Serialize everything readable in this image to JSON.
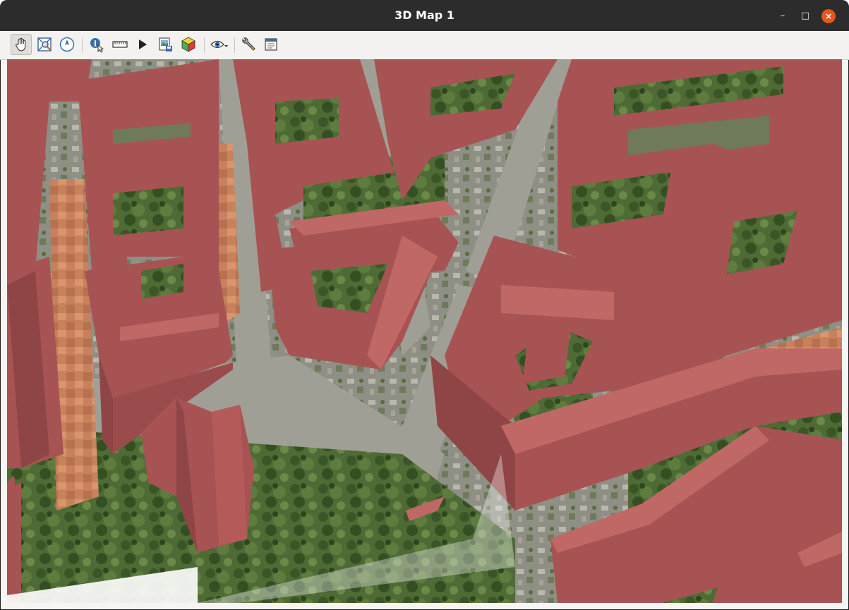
{
  "window": {
    "title": "3D Map 1",
    "controls": {
      "minimize": "–",
      "maximize": "□",
      "close": "×"
    }
  },
  "toolbar": {
    "tools": [
      {
        "name": "pan-tool",
        "icon": "hand-icon",
        "active": true
      },
      {
        "name": "zoom-full",
        "icon": "zoom-full-icon",
        "active": false
      },
      {
        "name": "camera-control",
        "icon": "compass-icon",
        "active": false
      },
      {
        "name": "identify-tool",
        "icon": "identify-icon",
        "active": false
      },
      {
        "name": "measure-tool",
        "icon": "ruler-icon",
        "active": false
      },
      {
        "name": "animations",
        "icon": "play-icon",
        "active": false
      },
      {
        "name": "save-image",
        "icon": "save-image-icon",
        "active": false
      },
      {
        "name": "export-3d-scene",
        "icon": "cube-icon",
        "active": false
      },
      {
        "name": "view-options",
        "icon": "eye-icon",
        "active": false
      },
      {
        "name": "configure",
        "icon": "wrench-icon",
        "active": false
      },
      {
        "name": "dock-toggle",
        "icon": "window-icon",
        "active": false
      }
    ]
  },
  "scene": {
    "building_color": "#a85353",
    "building_light": "#c06866",
    "building_dark": "#8f4545",
    "ground_green": "#4f6b35",
    "street_gray": "#9a9a92",
    "roof_orange": "#d0865c"
  }
}
